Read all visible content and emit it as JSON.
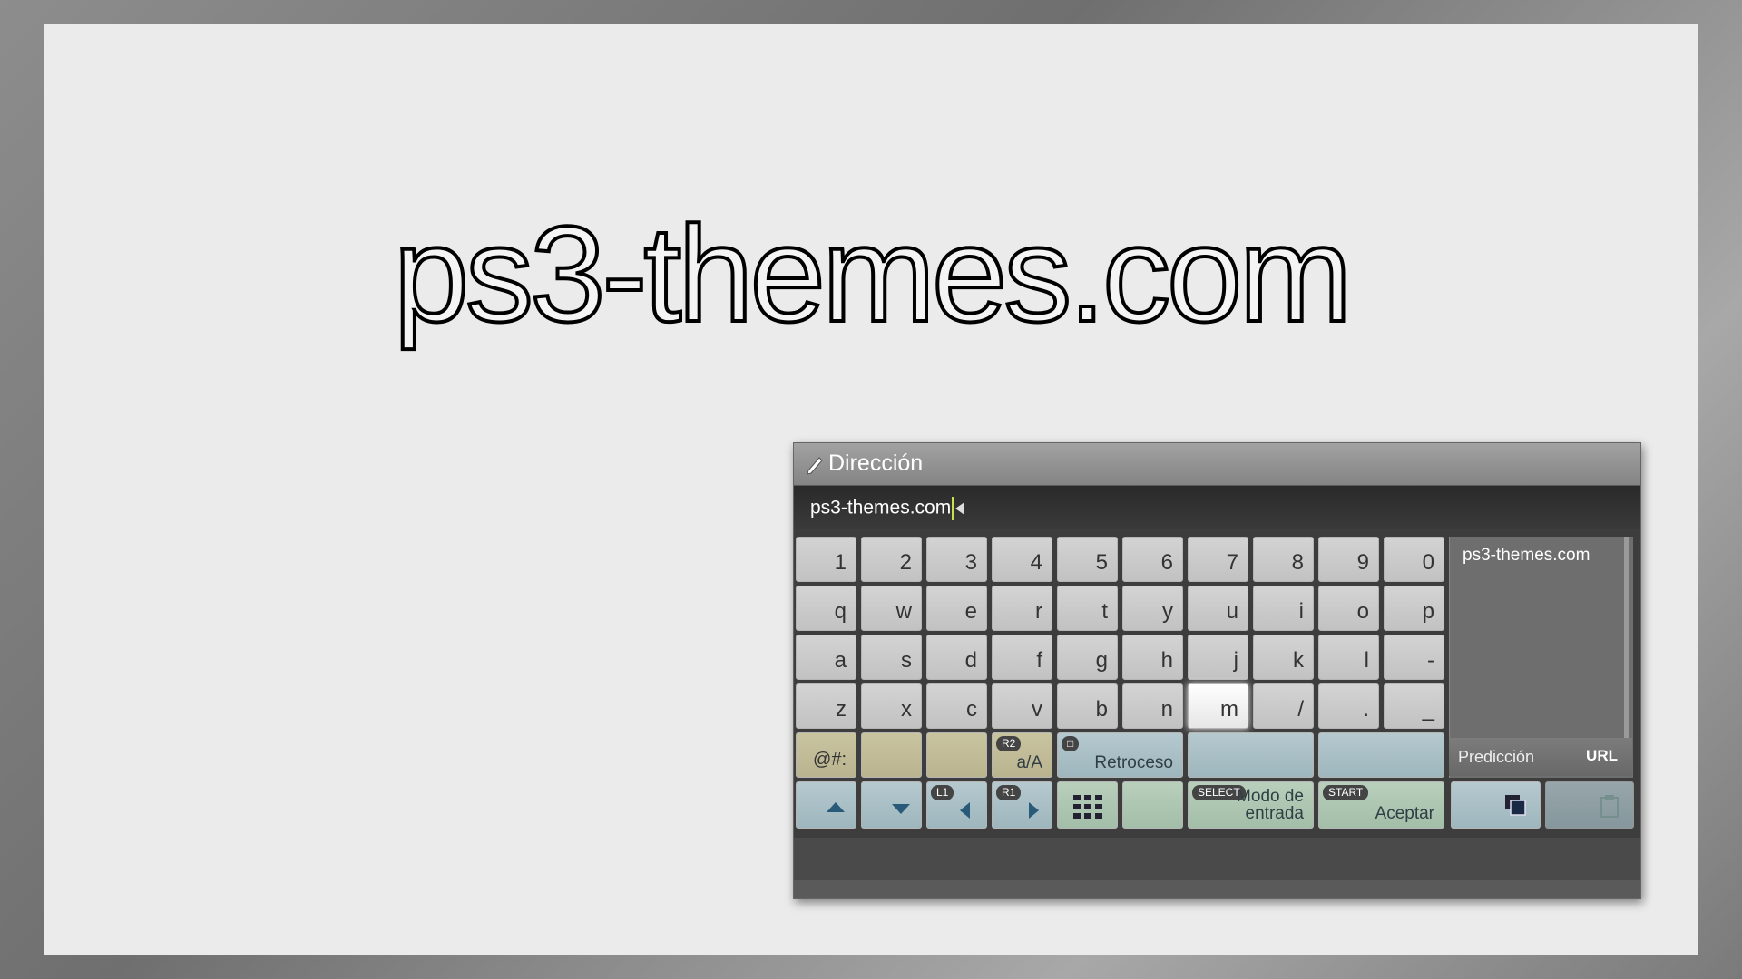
{
  "headline": "ps3-themes.com",
  "dialog": {
    "title": "Dirección",
    "input_value": "ps3-themes.com",
    "icon": "pencil-icon"
  },
  "keyboard": {
    "rows": [
      [
        "1",
        "2",
        "3",
        "4",
        "5",
        "6",
        "7",
        "8",
        "9",
        "0"
      ],
      [
        "q",
        "w",
        "e",
        "r",
        "t",
        "y",
        "u",
        "i",
        "o",
        "p"
      ],
      [
        "a",
        "s",
        "d",
        "f",
        "g",
        "h",
        "j",
        "k",
        "l",
        "-"
      ],
      [
        "z",
        "x",
        "c",
        "v",
        "b",
        "n",
        "m",
        "/",
        ".",
        "_"
      ]
    ],
    "selected_key": "m",
    "function_row": {
      "symbols_label": "@#:",
      "case_badge": "R2",
      "case_label": "a/A",
      "backspace_badge": "□",
      "backspace_label": "Retroceso"
    },
    "control_row": {
      "l1_badge": "L1",
      "r1_badge": "R1",
      "select_badge": "SELECT",
      "input_mode_label": "Modo de entrada",
      "start_badge": "START",
      "accept_label": "Aceptar"
    }
  },
  "prediction": {
    "items": [
      "ps3-themes.com"
    ],
    "label": "Predicción",
    "mode": "URL"
  },
  "colors": {
    "caret": "#c8e04a",
    "accent_arrows": "#2a5a7a"
  }
}
